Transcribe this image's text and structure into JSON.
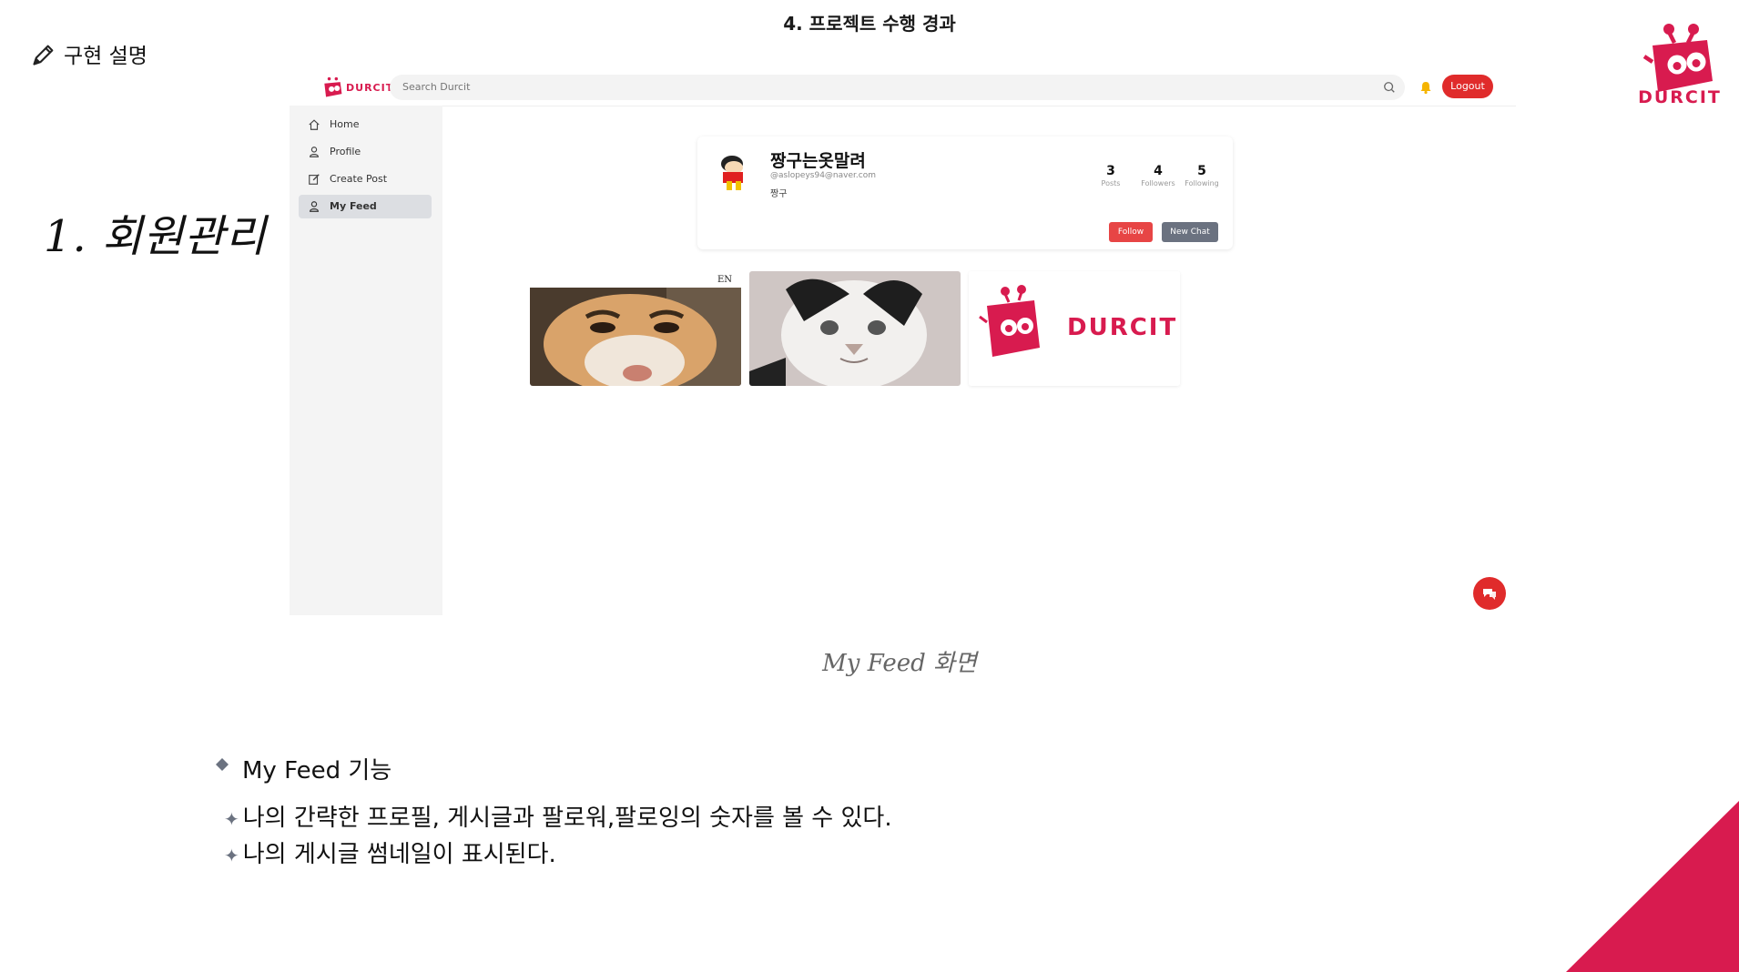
{
  "slide": {
    "title": "4. 프로젝트 수행 경과",
    "section_label": "구현 설명",
    "heading": "1. 회원관리",
    "brand_text": "DURCIT",
    "caption": "My Feed 화면",
    "accent_color": "#d81b4f"
  },
  "app": {
    "logo_text": "DURCIT",
    "search": {
      "placeholder": "Search Durcit"
    },
    "logout_label": "Logout",
    "sidebar": {
      "items": [
        {
          "label": "Home",
          "icon": "home-icon",
          "active": false
        },
        {
          "label": "Profile",
          "icon": "user-icon",
          "active": false
        },
        {
          "label": "Create Post",
          "icon": "edit-icon",
          "active": false
        },
        {
          "label": "My Feed",
          "icon": "user-icon",
          "active": true
        }
      ]
    },
    "profile": {
      "name": "짱구는옷말려",
      "email": "@aslopeys94@naver.com",
      "bio": "짱구",
      "stats": [
        {
          "value": "3",
          "label": "Posts"
        },
        {
          "value": "4",
          "label": "Followers"
        },
        {
          "value": "5",
          "label": "Following"
        }
      ],
      "follow_label": "Follow",
      "new_chat_label": "New Chat"
    },
    "thumbnail_logo_text": "DURCIT",
    "thumbnail_corner_text": "EN"
  },
  "features": {
    "heading": "My Feed 기능",
    "items": [
      "나의 간략한 프로필, 게시글과 팔로워,팔로잉의 숫자를 볼 수 있다.",
      "나의 게시글 썸네일이 표시된다."
    ]
  }
}
